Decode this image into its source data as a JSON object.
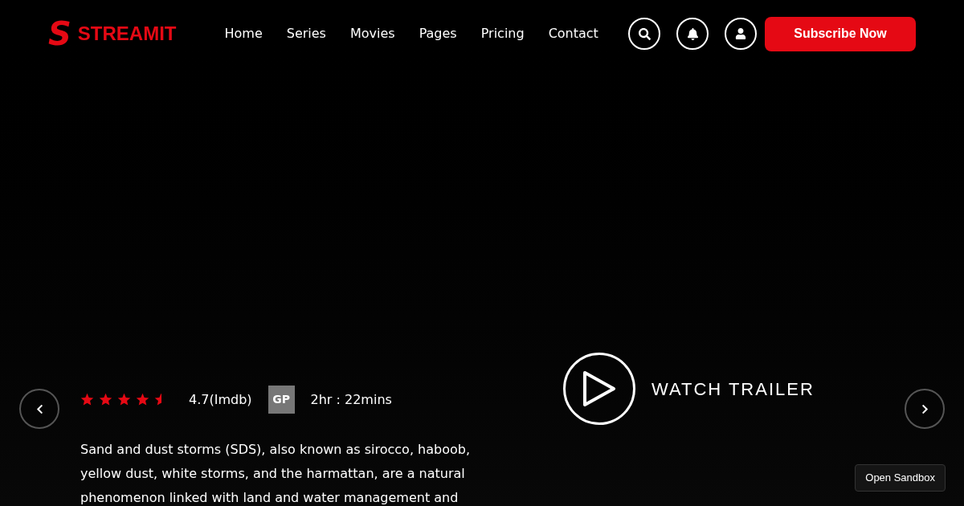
{
  "header": {
    "logo_letter": "S",
    "logo_text": "STREAMIT",
    "nav": [
      {
        "label": "Home"
      },
      {
        "label": "Series"
      },
      {
        "label": "Movies"
      },
      {
        "label": "Pages"
      },
      {
        "label": "Pricing"
      },
      {
        "label": "Contact"
      }
    ],
    "subscribe": "Subscribe Now"
  },
  "hero": {
    "stars": 4.5,
    "rating": "4.7(Imdb)",
    "badge": "GP",
    "duration": "2hr : 22mins",
    "description": "Sand and dust storms (SDS), also known as sirocco, haboob, yellow dust, white storms, and the harmattan, are a natural phenomenon linked with land and water management and",
    "trailer": "WATCH TRAILER"
  },
  "sandbox_button": "Open Sandbox"
}
